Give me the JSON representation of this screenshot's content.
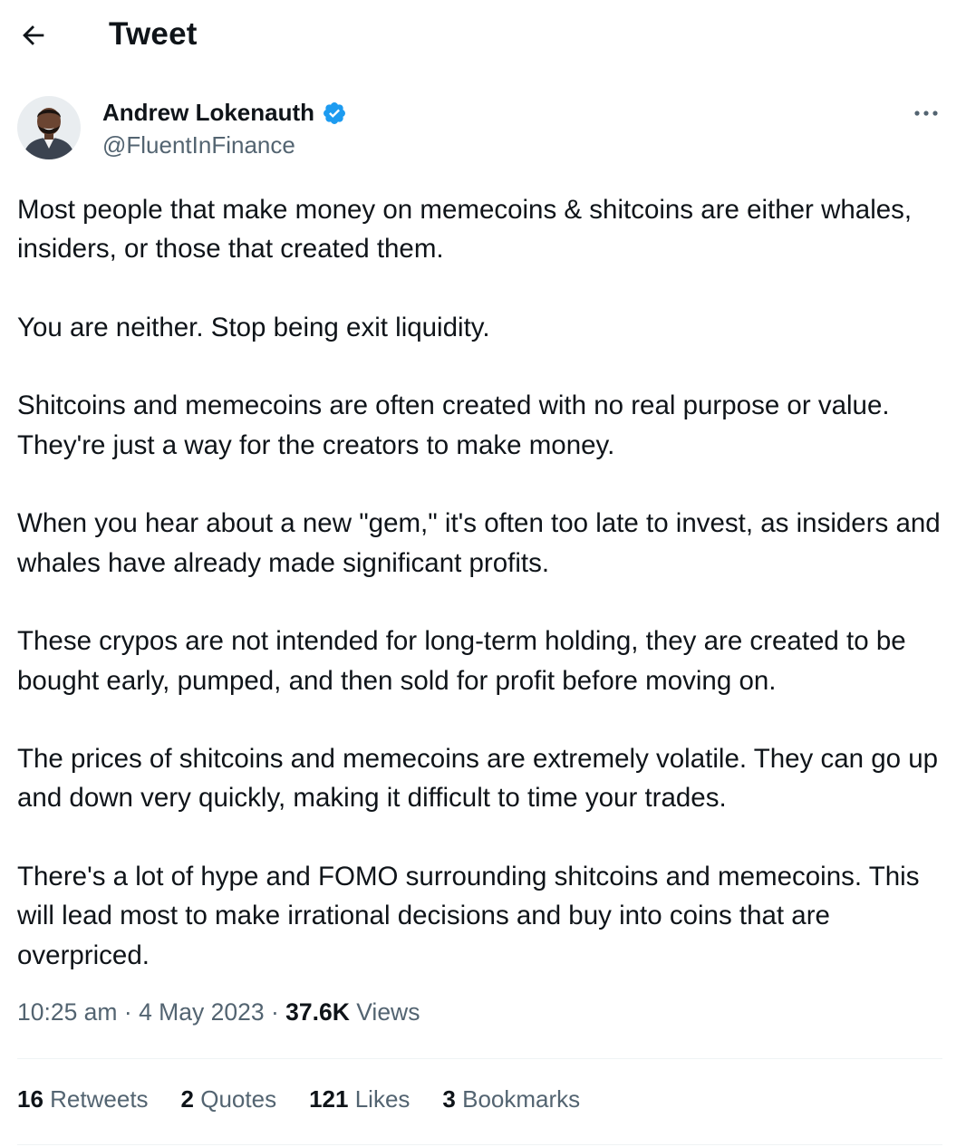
{
  "header": {
    "title": "Tweet"
  },
  "author": {
    "name": "Andrew Lokenauth",
    "handle": "@FluentInFinance"
  },
  "tweet": {
    "paragraphs": [
      "Most people that make money on memecoins & shitcoins are either whales, insiders, or those that created them.",
      "You are neither. Stop being exit liquidity.",
      "Shitcoins and memecoins are often created with no real purpose or value. They're just a way for the creators to make money.",
      "When you hear about a new \"gem,\" it's often too late to invest, as insiders and whales have already made significant profits.",
      "These crypos are not intended for long-term holding, they are created to be bought early, pumped, and then sold for profit before moving on.",
      "The prices of shitcoins and memecoins are extremely volatile. They can go up and down very quickly, making it difficult to time your trades.",
      "There's a lot of hype and FOMO surrounding shitcoins and memecoins. This will lead most to make irrational decisions and buy into coins that are overpriced."
    ]
  },
  "meta": {
    "time": "10:25 am",
    "separator": "·",
    "date": "4 May 2023",
    "views_count": "37.6K",
    "views_label": "Views"
  },
  "stats": {
    "retweets": {
      "count": "16",
      "label": "Retweets"
    },
    "quotes": {
      "count": "2",
      "label": "Quotes"
    },
    "likes": {
      "count": "121",
      "label": "Likes"
    },
    "bookmarks": {
      "count": "3",
      "label": "Bookmarks"
    }
  },
  "icons": {
    "back": "arrow-left-icon",
    "verified": "verified-badge-icon",
    "more": "more-horizontal-icon"
  },
  "colors": {
    "text_primary": "#0f1419",
    "text_secondary": "#536471",
    "verified_blue": "#1d9bf0",
    "divider": "#eff3f4"
  }
}
